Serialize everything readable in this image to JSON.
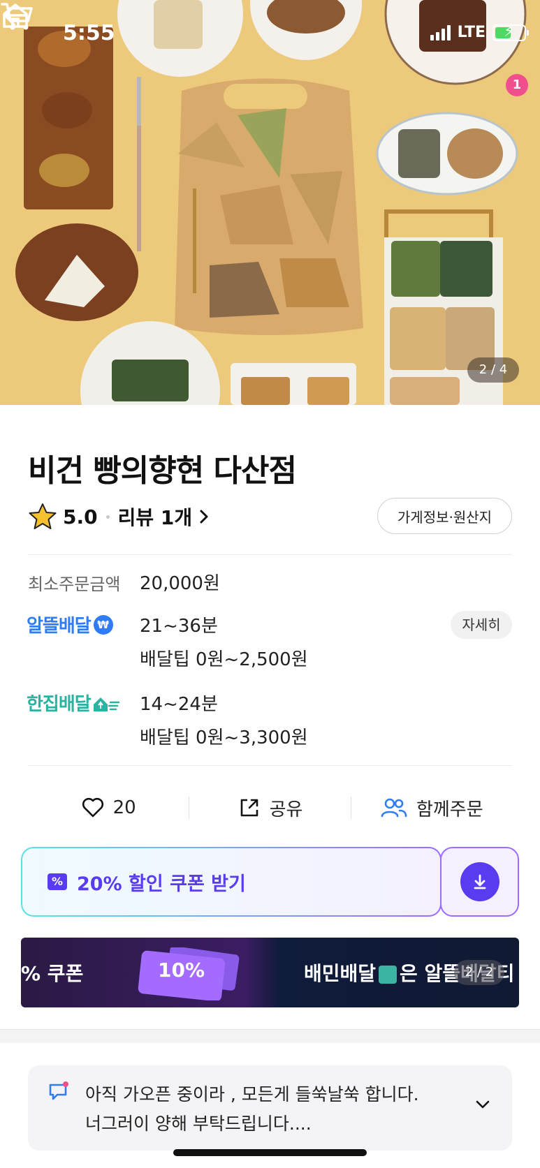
{
  "status_bar": {
    "time": "5:55",
    "network": "LTE"
  },
  "header": {
    "cart_count": "1",
    "image_counter": "2 / 4"
  },
  "store": {
    "name": "비건 빵의향현 다산점",
    "rating": "5.0",
    "reviews_label": "리뷰 1개",
    "info_button": "가게정보·원산지"
  },
  "order": {
    "min_label": "최소주문금액",
    "min_value": "20,000원"
  },
  "delivery_options": [
    {
      "name": "알뜰배달",
      "icon": "won-icon",
      "time": "21~36분",
      "tip": "배달팁 0원~2,500원",
      "detail_label": "자세히"
    },
    {
      "name": "한집배달",
      "icon": "house-arrow-icon",
      "time": "14~24분",
      "tip": "배달팁 0원~3,300원"
    }
  ],
  "actions": {
    "likes": "20",
    "share": "공유",
    "group_order": "함께주문"
  },
  "coupon": {
    "label": "20% 할인 쿠폰 받기",
    "icon": "percent-icon"
  },
  "banner": {
    "left_text": "% 쿠폰",
    "ticket_text": "10%",
    "right_text": "배민배달",
    "right_text2": "은 알뜰배달티",
    "counter": "2 / 2"
  },
  "notice": {
    "line1": "아직 가오픈 중이라 , 모든게 들쑥날쑥 합니다.",
    "line2": "너그러이 양해 부탁드립니다...."
  },
  "colors": {
    "accent_purple": "#5a3cf0",
    "delivery_blue": "#2f7cf6",
    "delivery_teal": "#29b3a0",
    "badge_pink": "#f04e8c"
  }
}
